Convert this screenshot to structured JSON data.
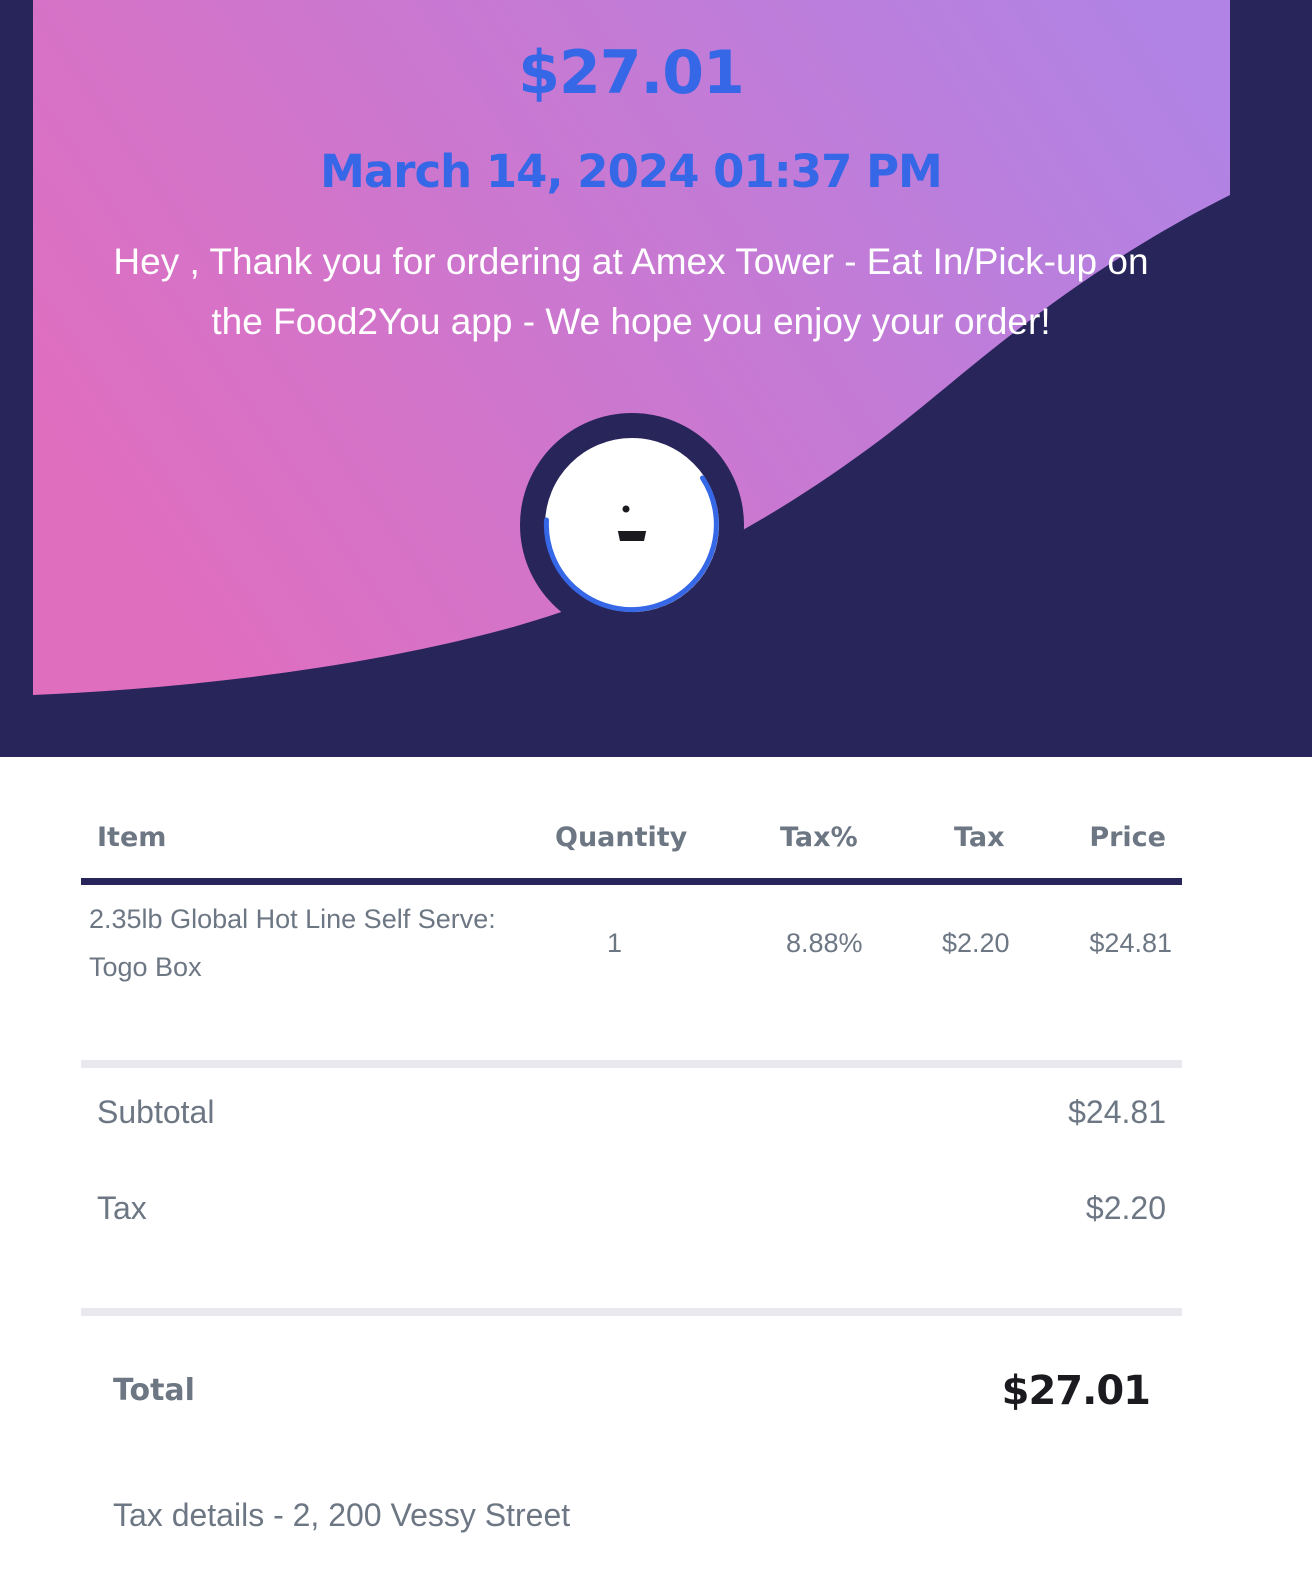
{
  "header": {
    "amount": "$27.01",
    "datetime": "March 14, 2024 01:37 PM",
    "message": "Hey , Thank you for ordering at Amex Tower - Eat In/Pick-up on the Food2You app - We hope you enjoy your order!",
    "icon": "food-bag-icon"
  },
  "table": {
    "headers": {
      "item": "Item",
      "quantity": "Quantity",
      "tax_pct": "Tax%",
      "tax": "Tax",
      "price": "Price"
    },
    "rows": [
      {
        "item": "2.35lb Global Hot Line Self Serve: Togo Box",
        "quantity": "1",
        "tax_pct": "8.88%",
        "tax": "$2.20",
        "price": "$24.81"
      }
    ]
  },
  "summary": {
    "subtotal_label": "Subtotal",
    "subtotal_value": "$24.81",
    "tax_label": "Tax",
    "tax_value": "$2.20",
    "total_label": "Total",
    "total_value": "$27.01"
  },
  "footer": {
    "tax_details": "Tax details - 2, 200 Vessy Street"
  },
  "colors": {
    "navy": "#28255a",
    "accent_blue": "#3567e6",
    "gradient_start": "#e06ebf",
    "gradient_end": "#b183e4",
    "muted_text": "#6d7784"
  }
}
